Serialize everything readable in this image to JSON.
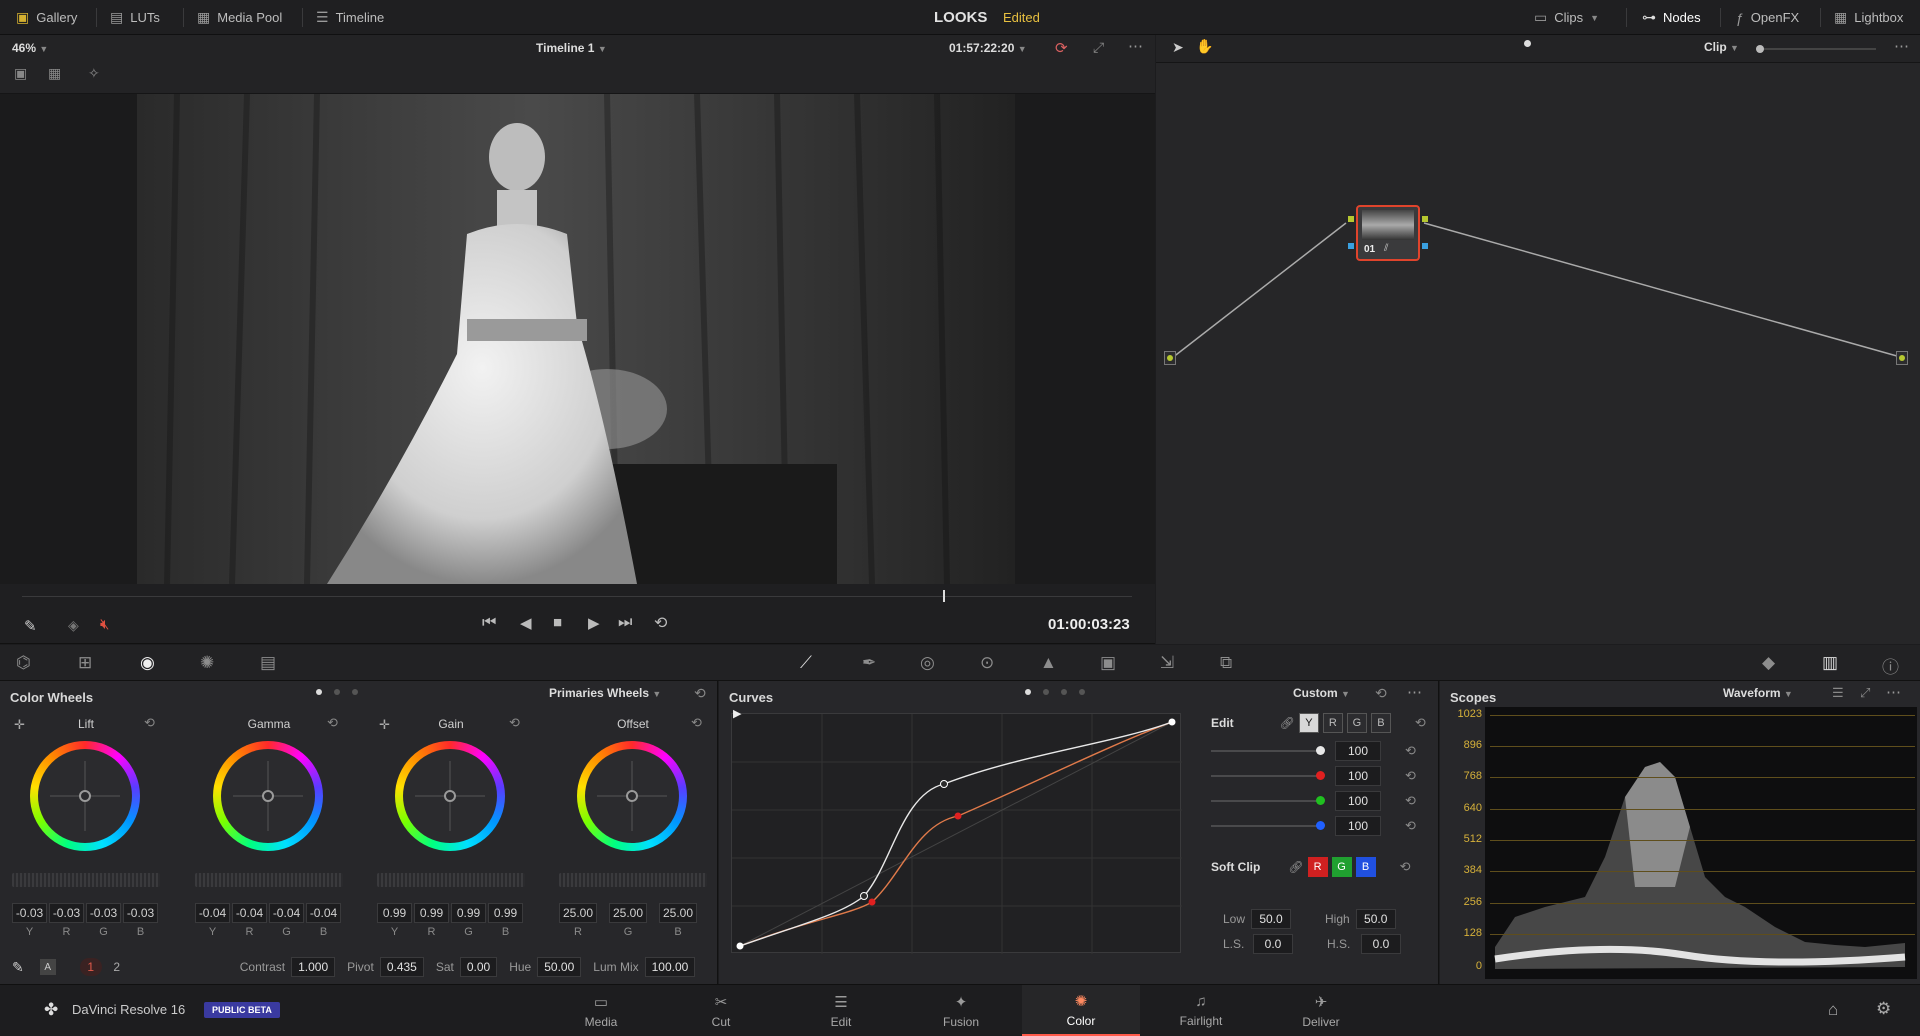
{
  "topnav": {
    "left": [
      {
        "label": "Gallery",
        "icon": "gallery-icon"
      },
      {
        "label": "LUTs",
        "icon": "luts-icon"
      },
      {
        "label": "Media Pool",
        "icon": "media-pool-icon"
      },
      {
        "label": "Timeline",
        "icon": "timeline-icon"
      }
    ],
    "project_title": "LOOKS",
    "project_status": "Edited",
    "right": [
      {
        "label": "Clips",
        "icon": "clips-icon"
      },
      {
        "label": "Nodes",
        "icon": "nodes-icon"
      },
      {
        "label": "OpenFX",
        "icon": "openfx-icon"
      },
      {
        "label": "Lightbox",
        "icon": "lightbox-icon"
      }
    ]
  },
  "viewer": {
    "zoom": "46%",
    "timeline_name": "Timeline 1",
    "timecode_top": "01:57:22:20",
    "timecode_current": "01:00:03:23",
    "playhead_fraction": 0.83
  },
  "nodes": {
    "mode_label": "Clip",
    "node_label": "01"
  },
  "color_wheels": {
    "title": "Color Wheels",
    "mode": "Primaries Wheels",
    "wheels": [
      {
        "name": "Lift",
        "values": [
          "-0.03",
          "-0.03",
          "-0.03",
          "-0.03"
        ],
        "channels": [
          "Y",
          "R",
          "G",
          "B"
        ]
      },
      {
        "name": "Gamma",
        "values": [
          "-0.04",
          "-0.04",
          "-0.04",
          "-0.04"
        ],
        "channels": [
          "Y",
          "R",
          "G",
          "B"
        ]
      },
      {
        "name": "Gain",
        "values": [
          "0.99",
          "0.99",
          "0.99",
          "0.99"
        ],
        "channels": [
          "Y",
          "R",
          "G",
          "B"
        ]
      },
      {
        "name": "Offset",
        "values": [
          "25.00",
          "25.00",
          "25.00"
        ],
        "channels": [
          "R",
          "G",
          "B"
        ]
      }
    ],
    "pages": [
      "1",
      "2"
    ],
    "controls": {
      "contrast_label": "Contrast",
      "contrast": "1.000",
      "pivot_label": "Pivot",
      "pivot": "0.435",
      "sat_label": "Sat",
      "sat": "0.00",
      "hue_label": "Hue",
      "hue": "50.00",
      "lummix_label": "Lum Mix",
      "lummix": "100.00"
    }
  },
  "curves": {
    "title": "Curves",
    "mode": "Custom",
    "edit_label": "Edit",
    "channels": [
      "Y",
      "R",
      "G",
      "B"
    ],
    "intensity": [
      {
        "color": "#e8e8e8",
        "value": "100"
      },
      {
        "color": "#e02020",
        "value": "100"
      },
      {
        "color": "#20c020",
        "value": "100"
      },
      {
        "color": "#2060ff",
        "value": "100"
      }
    ],
    "soft_clip_label": "Soft Clip",
    "soft_clip_channels": [
      "R",
      "G",
      "B"
    ],
    "low_label": "Low",
    "low": "50.0",
    "high_label": "High",
    "high": "50.0",
    "ls_label": "L.S.",
    "ls": "0.0",
    "hs_label": "H.S.",
    "hs": "0.0"
  },
  "scopes": {
    "title": "Scopes",
    "mode": "Waveform",
    "scale": [
      "1023",
      "896",
      "768",
      "640",
      "512",
      "384",
      "256",
      "128",
      "0"
    ]
  },
  "pagebar": {
    "app_name": "DaVinci Resolve 16",
    "badge": "PUBLIC BETA",
    "pages": [
      {
        "label": "Media",
        "icon": "media-page-icon"
      },
      {
        "label": "Cut",
        "icon": "cut-page-icon"
      },
      {
        "label": "Edit",
        "icon": "edit-page-icon"
      },
      {
        "label": "Fusion",
        "icon": "fusion-page-icon"
      },
      {
        "label": "Color",
        "icon": "color-page-icon",
        "active": true
      },
      {
        "label": "Fairlight",
        "icon": "fairlight-page-icon"
      },
      {
        "label": "Deliver",
        "icon": "deliver-page-icon"
      }
    ]
  },
  "colors": {
    "accent_active": "#ff5a4a",
    "edited": "#e8c040",
    "scope_lines": "#d6b13a"
  }
}
